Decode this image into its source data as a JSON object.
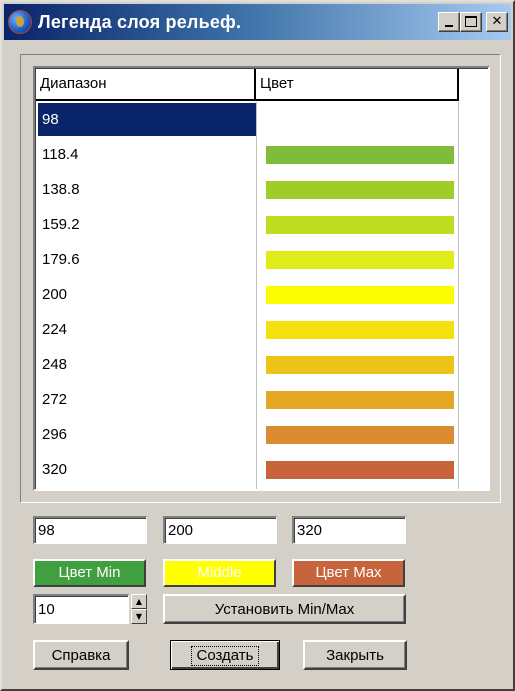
{
  "window": {
    "title": "Легенда слоя рельеф."
  },
  "list": {
    "columns": [
      "Диапазон",
      "Цвет"
    ],
    "rows": [
      {
        "range": "98",
        "color": "",
        "selected": true
      },
      {
        "range": "118.4",
        "color": "#80bc3c"
      },
      {
        "range": "138.8",
        "color": "#a0cc28"
      },
      {
        "range": "159.2",
        "color": "#c0dc20"
      },
      {
        "range": "179.6",
        "color": "#e0ec18"
      },
      {
        "range": "200",
        "color": "#fcfc00"
      },
      {
        "range": "224",
        "color": "#f4e00c"
      },
      {
        "range": "248",
        "color": "#ecc418"
      },
      {
        "range": "272",
        "color": "#e4a824"
      },
      {
        "range": "296",
        "color": "#dc8c30"
      },
      {
        "range": "320",
        "color": "#c8643c"
      }
    ]
  },
  "fields": {
    "min": "98",
    "middle": "200",
    "max": "320"
  },
  "colors": {
    "min_label": "Цвет Min",
    "min_color": "#40a040",
    "middle_label": "Middle",
    "middle_color": "#ffff00",
    "max_label": "Цвет Max",
    "max_color": "#c8643c"
  },
  "steps": {
    "value": "10"
  },
  "buttons": {
    "set_minmax": "Установить Min/Max",
    "help": "Справка",
    "create": "Создать",
    "close": "Закрыть"
  }
}
